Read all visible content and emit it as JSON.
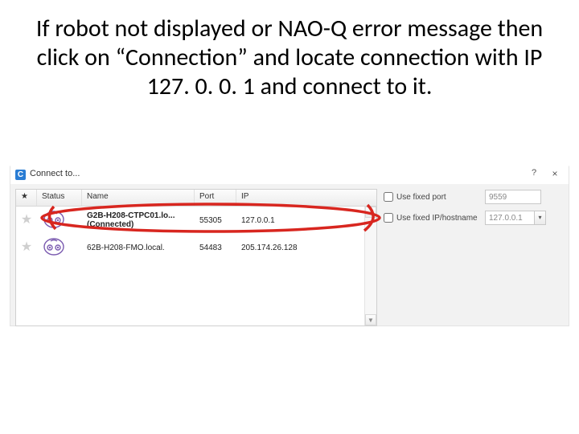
{
  "instruction": "If robot not displayed or NAO-Q error message then click on “Connection” and locate connection with IP 127. 0. 0. 1 and connect to it.",
  "dialog": {
    "title": "Connect to...",
    "help_glyph": "?",
    "close_glyph": "×",
    "options": {
      "fixed_port_label": "Use fixed port",
      "fixed_port_value": "9559",
      "fixed_ip_label": "Use fixed IP/hostname",
      "fixed_ip_value": "127.0.0.1"
    },
    "columns": {
      "star": "★",
      "status": "Status",
      "name": "Name",
      "port": "Port",
      "ip": "IP"
    },
    "rows": [
      {
        "name": "G2B-H208-CTPC01.lo...",
        "sub": "(Connected)",
        "port": "55305",
        "ip": "127.0.0.1"
      },
      {
        "name": "62B-H208-FMO.local.",
        "sub": "",
        "port": "54483",
        "ip": "205.174.26.128"
      }
    ]
  },
  "icons": {
    "robot_color": "#7b5bb0",
    "annotation_color": "#d8261f"
  }
}
